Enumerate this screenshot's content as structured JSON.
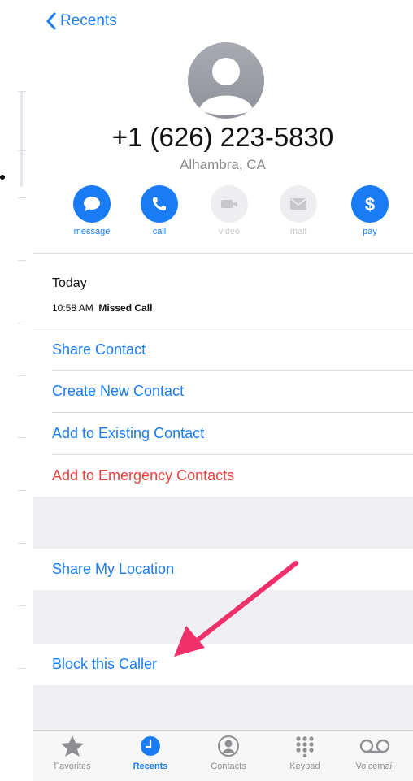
{
  "nav": {
    "back_label": "Recents"
  },
  "contact": {
    "phone": "+1 (626) 223-5830",
    "location": "Alhambra, CA"
  },
  "actions": [
    {
      "label": "message",
      "enabled": true
    },
    {
      "label": "call",
      "enabled": true
    },
    {
      "label": "video",
      "enabled": false
    },
    {
      "label": "mail",
      "enabled": false
    },
    {
      "label": "pay",
      "enabled": true
    }
  ],
  "history": {
    "day": "Today",
    "time": "10:58 AM",
    "event": "Missed Call"
  },
  "options": {
    "share_contact": "Share Contact",
    "create_new_contact": "Create New Contact",
    "add_to_existing": "Add to Existing Contact",
    "add_to_emergency": "Add to Emergency Contacts",
    "share_location": "Share My Location",
    "block_caller": "Block this Caller"
  },
  "tabs": [
    {
      "label": "Favorites",
      "selected": false
    },
    {
      "label": "Recents",
      "selected": true
    },
    {
      "label": "Contacts",
      "selected": false
    },
    {
      "label": "Keypad",
      "selected": false
    },
    {
      "label": "Voicemail",
      "selected": false
    }
  ],
  "colors": {
    "accent": "#1a7cf5",
    "destructive": "#e8403a",
    "annotation_arrow": "#f0306a"
  }
}
